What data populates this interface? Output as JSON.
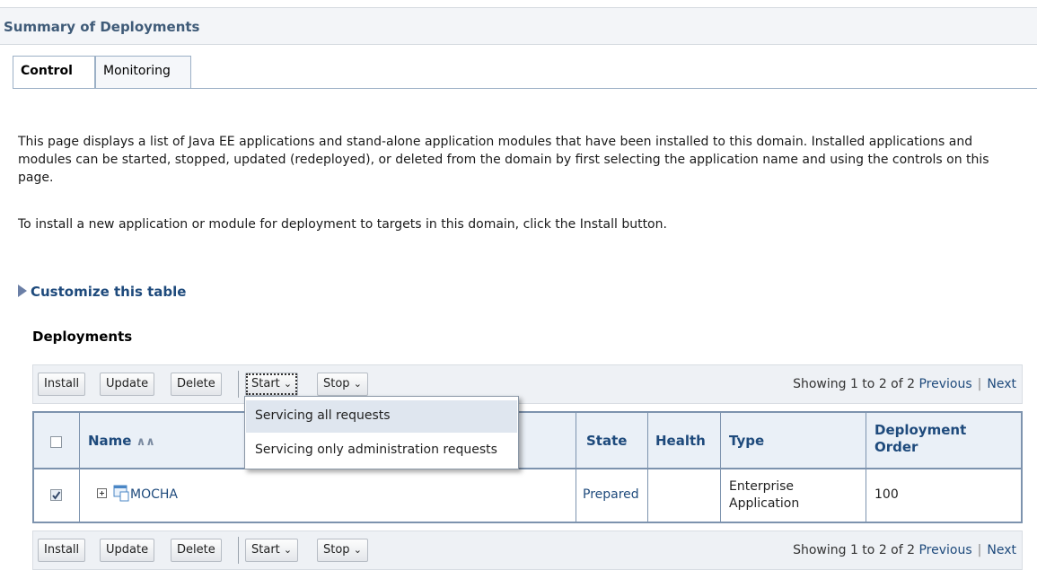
{
  "header": {
    "title": "Summary of Deployments"
  },
  "tabs": [
    {
      "label": "Control"
    },
    {
      "label": "Monitoring"
    }
  ],
  "description": {
    "p1": "This page displays a list of Java EE applications and stand-alone application modules that have been installed to this domain. Installed applications and modules can be started, stopped, updated (redeployed), or deleted from the domain by first selecting the application name and using the controls on this page.",
    "p2": "To install a new application or module for deployment to targets in this domain, click the Install button."
  },
  "customize": {
    "label": "Customize this table"
  },
  "section": {
    "title": "Deployments"
  },
  "toolbar": {
    "install": "Install",
    "update": "Update",
    "delete": "Delete",
    "start": "Start",
    "stop": "Stop",
    "paging": "Showing 1 to 2 of 2",
    "previous": "Previous",
    "next": "Next"
  },
  "start_menu": [
    "Servicing all requests",
    "Servicing only administration requests"
  ],
  "table": {
    "columns": {
      "name": "Name",
      "state": "State",
      "health": "Health",
      "type": "Type",
      "order": "Deployment Order"
    },
    "rows": [
      {
        "name": "MOCHA",
        "state": "Prepared",
        "health": "",
        "type": "Enterprise Application",
        "order": "100",
        "checked": true
      }
    ]
  },
  "colors": {
    "link": "#1e4a7c",
    "header_bg": "#eaf0f7",
    "border": "#7d93ae"
  },
  "icons": {
    "expand": "plus-box-icon",
    "app": "application-icon",
    "sort": "sort-up-icon",
    "dropdown": "chevron-down-icon"
  }
}
